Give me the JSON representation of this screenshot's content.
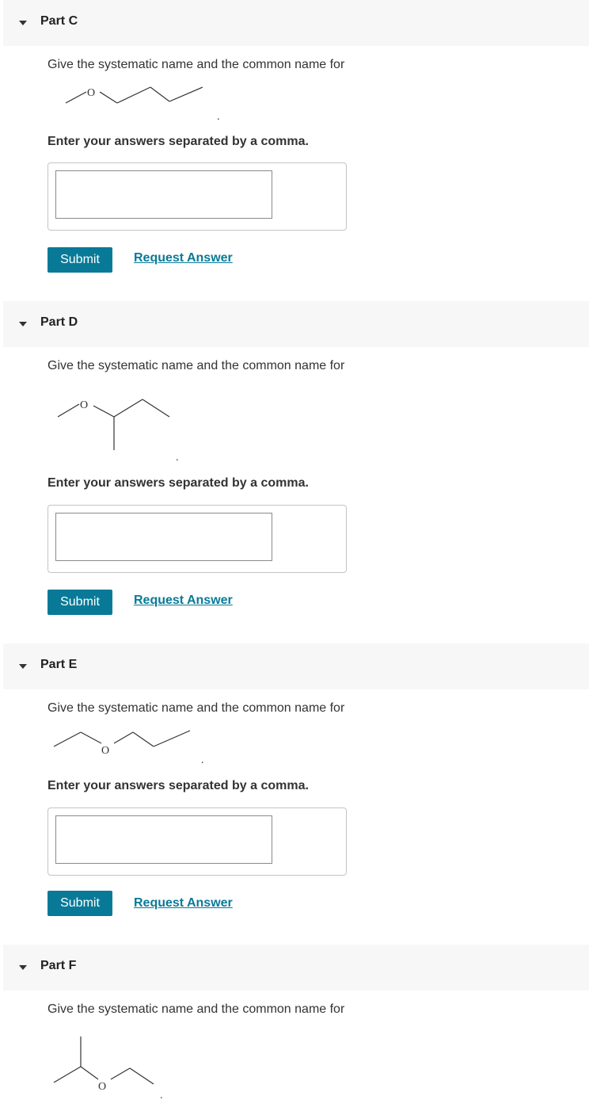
{
  "parts": [
    {
      "title": "Part C",
      "prompt": "Give the systematic name and the common name for",
      "atom_label": "O",
      "period": ".",
      "instruction": "Enter your answers separated by a comma.",
      "answer_value": "",
      "submit_label": "Submit",
      "request_label": "Request Answer"
    },
    {
      "title": "Part D",
      "prompt": "Give the systematic name and the common name for",
      "atom_label": "O",
      "period": ".",
      "instruction": "Enter your answers separated by a comma.",
      "answer_value": "",
      "submit_label": "Submit",
      "request_label": "Request Answer"
    },
    {
      "title": "Part E",
      "prompt": "Give the systematic name and the common name for",
      "atom_label": "O",
      "period": ".",
      "instruction": "Enter your answers separated by a comma.",
      "answer_value": "",
      "submit_label": "Submit",
      "request_label": "Request Answer"
    },
    {
      "title": "Part F",
      "prompt": "Give the systematic name and the common name for",
      "atom_label": "O",
      "period": "."
    }
  ],
  "colors": {
    "accent": "#087a98",
    "header_bg": "#f7f7f7"
  },
  "icons": {
    "collapse": "caret-down-icon"
  }
}
